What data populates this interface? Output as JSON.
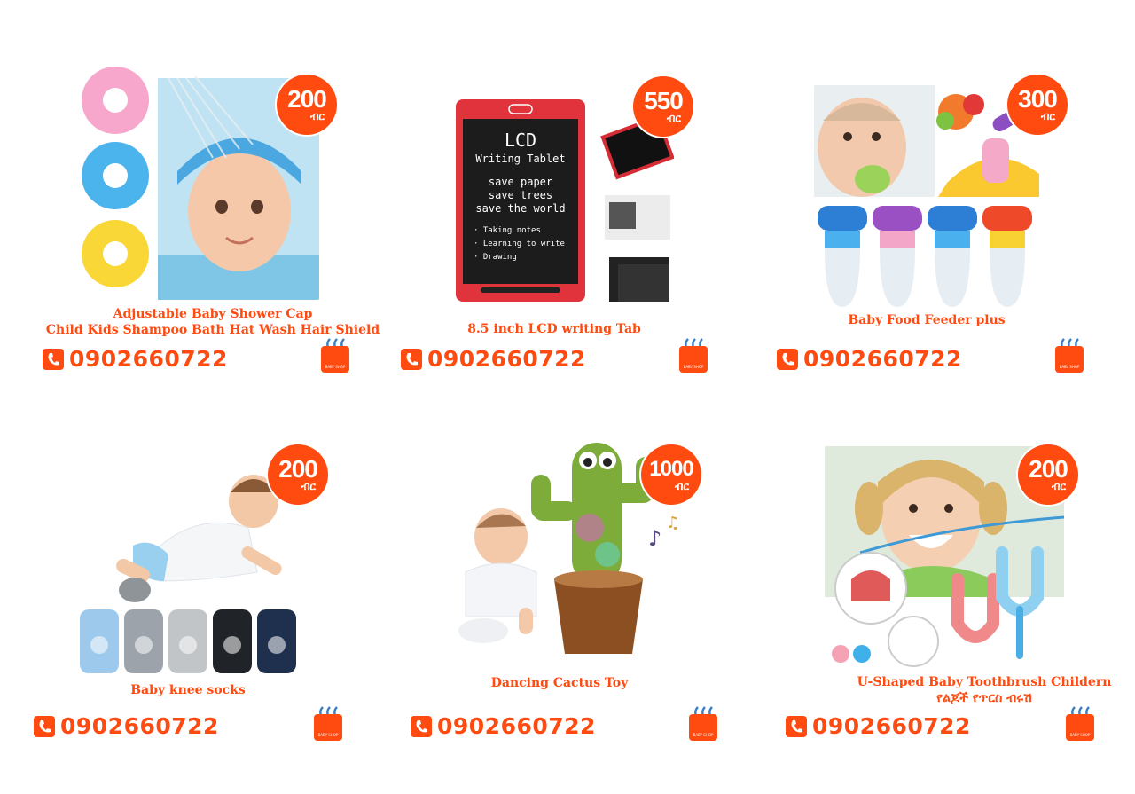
{
  "phone_number": "0902660722",
  "currency": "ብር",
  "accent_color": "#ff4a10",
  "products": [
    {
      "title": "Adjustable Baby Shower Cap",
      "title2": "Child Kids Shampoo Bath Hat Wash Hair Shield",
      "price": "200"
    },
    {
      "title": "8.5 inch LCD writing Tab",
      "price": "550",
      "tablet_text": [
        "LCD",
        "Writing Tablet",
        "save paper",
        "save trees",
        "save the world",
        "· Taking notes",
        "· Learning to write",
        "· Drawing"
      ]
    },
    {
      "title": "Baby Food Feeder plus",
      "price": "300"
    },
    {
      "title": "Baby knee socks",
      "price": "200"
    },
    {
      "title": "Dancing Cactus Toy",
      "price": "1000"
    },
    {
      "title": "U-Shaped Baby Toothbrush Childern",
      "title2": "የልጆች የጥርስ ብሩሽ",
      "price": "200"
    }
  ]
}
